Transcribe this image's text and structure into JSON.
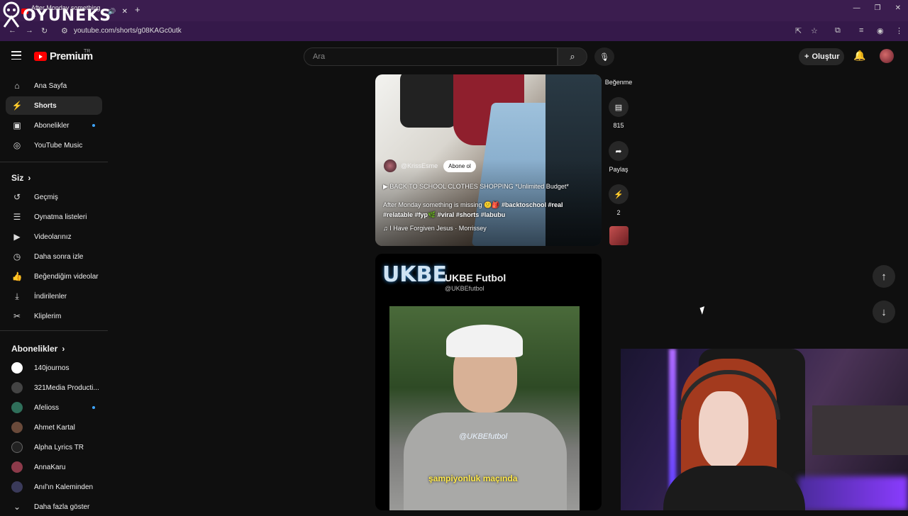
{
  "browser": {
    "tab_title": "After Monday something is",
    "new_tab": "+",
    "url": "youtube.com/shorts/g08KAGc0utk"
  },
  "overlay_logo": "OYUNEKS",
  "header": {
    "brand": "Premium",
    "region": "TR",
    "search_placeholder": "Ara",
    "create_label": "Oluştur"
  },
  "sidebar": {
    "main_items": [
      {
        "label": "Ana Sayfa",
        "icon": "home-icon"
      },
      {
        "label": "Shorts",
        "icon": "shorts-icon",
        "active": true
      },
      {
        "label": "Abonelikler",
        "icon": "subscriptions-icon",
        "new": true
      },
      {
        "label": "YouTube Music",
        "icon": "music-icon"
      }
    ],
    "you_heading": "Siz",
    "you_items": [
      {
        "label": "Geçmiş",
        "icon": "history-icon"
      },
      {
        "label": "Oynatma listeleri",
        "icon": "playlists-icon"
      },
      {
        "label": "Videolarınız",
        "icon": "your-videos-icon"
      },
      {
        "label": "Daha sonra izle",
        "icon": "watch-later-icon"
      },
      {
        "label": "Beğendiğim videolar",
        "icon": "like-icon"
      },
      {
        "label": "İndirilenler",
        "icon": "download-icon"
      },
      {
        "label": "Kliplerim",
        "icon": "clips-icon"
      }
    ],
    "subs_heading": "Abonelikler",
    "subs": [
      {
        "label": "140journos",
        "color": "#ffffff"
      },
      {
        "label": "321Media Producti...",
        "color": "#444444"
      },
      {
        "label": "Afelioss",
        "color": "#2f6f5a",
        "new": true
      },
      {
        "label": "Ahmet Kartal",
        "color": "#6a4a3a"
      },
      {
        "label": "Alpha Lyrics TR",
        "color": "#222222"
      },
      {
        "label": "AnnaKaru",
        "color": "#8c3a4a"
      },
      {
        "label": "Anıl'ın Kaleminden",
        "color": "#3a3a5a"
      }
    ],
    "show_more": "Daha fazla göster"
  },
  "short1": {
    "channel": "@KrissEsme",
    "subscribe": "Abone ol",
    "playlist": "BACK TO SCHOOL CLOTHES SHOPPING *Unlimited Budget*",
    "caption": "After Monday something is missing 😕🎒",
    "tags_inline": "#backtoschool #real",
    "tags_line2": "#relatable #fyp🌿 #viral #shorts #labubu",
    "sound": "I Have Forgiven Jesus · Morrissey"
  },
  "actions": {
    "dislike_label": "Beğenme",
    "comments_count": "815",
    "share_label": "Paylaş",
    "remix_count": "2"
  },
  "short2": {
    "logo_text": "UKBE",
    "title": "UKBE Futbol",
    "handle": "@UKBEfutbol",
    "watermark": "@UKBEfutbol",
    "subtitle": "şampiyonluk maçında"
  },
  "nav": {
    "up_icon": "arrow-up-icon",
    "down_icon": "arrow-down-icon"
  }
}
